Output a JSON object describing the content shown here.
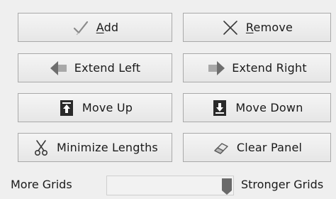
{
  "buttons": {
    "add": {
      "label": "Add",
      "mnemonic": "A",
      "rest": "dd",
      "icon": "checkmark-icon"
    },
    "remove": {
      "label": "Remove",
      "mnemonic": "R",
      "rest": "emove",
      "icon": "x-icon"
    },
    "extend_left": {
      "label": "Extend Left",
      "icon": "arrow-left-icon"
    },
    "extend_right": {
      "label": "Extend Right",
      "icon": "arrow-right-icon"
    },
    "move_up": {
      "label": "Move Up",
      "icon": "move-up-icon"
    },
    "move_down": {
      "label": "Move Down",
      "icon": "move-down-icon"
    },
    "minimize_lengths": {
      "label": "Minimize Lengths",
      "icon": "scissors-icon"
    },
    "clear_panel": {
      "label": "Clear Panel",
      "icon": "eraser-icon"
    }
  },
  "slider": {
    "left_label": "More Grids",
    "right_label": "Stronger Grids",
    "value_fraction": 0.95
  }
}
